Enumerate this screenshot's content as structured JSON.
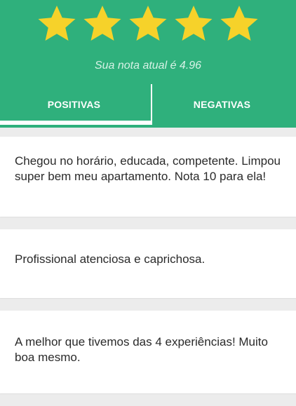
{
  "header": {
    "stars_count": 5,
    "stars_color": "#f6d22a",
    "rating_text": "Sua nota atual é 4.96",
    "bg_color": "#2fb07c"
  },
  "tabs": [
    {
      "label": "POSITIVAS",
      "active": true
    },
    {
      "label": "NEGATIVAS",
      "active": false
    }
  ],
  "reviews": [
    {
      "text": "Chegou no horário, educada, competente. Limpou super bem meu apartamento. Nota 10 para ela!"
    },
    {
      "text": "Profissional atenciosa e caprichosa."
    },
    {
      "text": "A melhor que tivemos das 4 experiências! Muito boa mesmo."
    }
  ]
}
